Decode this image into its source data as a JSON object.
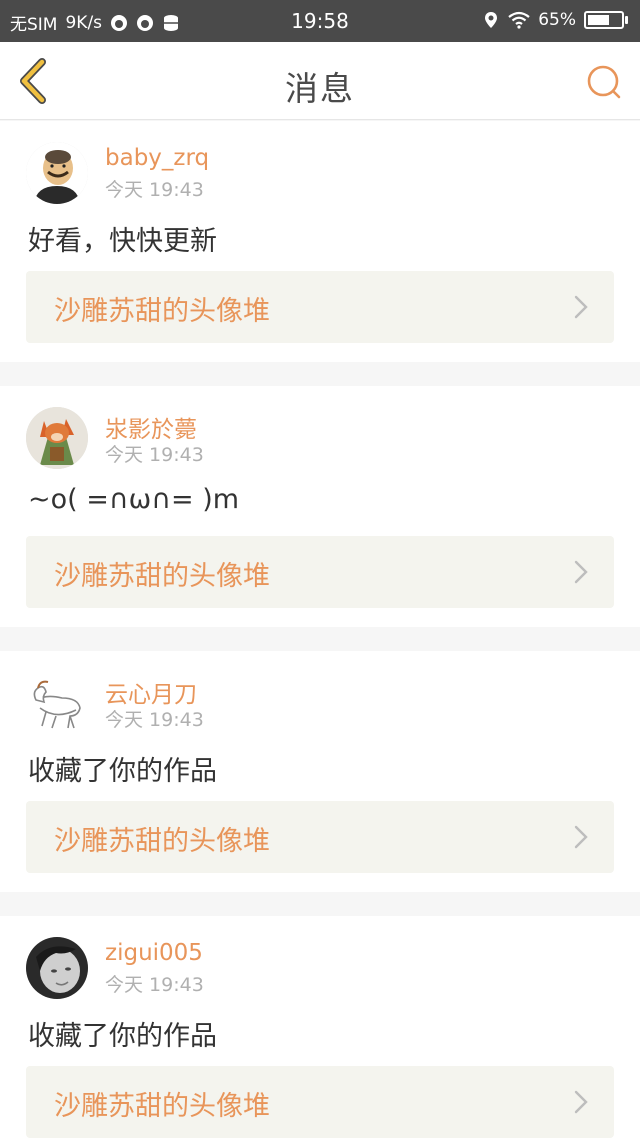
{
  "status_bar": {
    "carrier": "无SIM",
    "speed": "9K/s",
    "time": "19:58",
    "battery": "65%",
    "battery_level": 0.65
  },
  "nav": {
    "title": "消息"
  },
  "colors": {
    "accent": "#e8955a",
    "back_icon": "#f0c040"
  },
  "messages": [
    {
      "username": "baby_zrq",
      "time": "今天 19:43",
      "text": "好看，快快更新",
      "link": "沙雕苏甜的头像堆",
      "avatar_icon": "bald-man-avatar"
    },
    {
      "username": "汖影於薨",
      "time": "今天 19:43",
      "text": "~o( =∩ω∩= )m",
      "link": "沙雕苏甜的头像堆",
      "avatar_icon": "fox-cartoon-avatar"
    },
    {
      "username": "云心月刀",
      "time": "今天 19:43",
      "text": "收藏了你的作品",
      "link": "沙雕苏甜的头像堆",
      "avatar_icon": "goat-avatar"
    },
    {
      "username": "zigui005",
      "time": "今天 19:43",
      "text": "收藏了你的作品",
      "link": "沙雕苏甜的头像堆",
      "avatar_icon": "person-photo-avatar"
    }
  ]
}
